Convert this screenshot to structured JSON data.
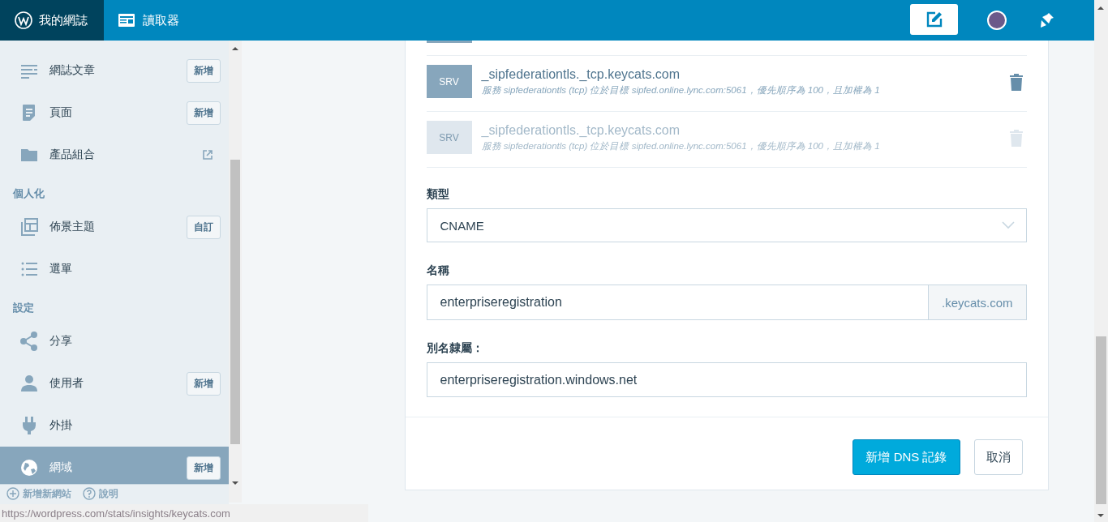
{
  "masterbar": {
    "my_sites": "我的網誌",
    "reader": "讀取器"
  },
  "sidebar": {
    "groups": [
      {
        "items": [
          {
            "label": "網誌文章",
            "kind": "posts",
            "action": {
              "kind": "button",
              "label": "新增"
            },
            "selected": false
          },
          {
            "label": "頁面",
            "kind": "page",
            "action": {
              "kind": "button",
              "label": "新增"
            },
            "selected": false
          },
          {
            "label": "產品組合",
            "kind": "folder",
            "action": {
              "kind": "external"
            },
            "selected": false
          }
        ]
      },
      {
        "heading": "個人化",
        "items": [
          {
            "label": "佈景主題",
            "kind": "themes",
            "action": {
              "kind": "button",
              "label": "自訂"
            },
            "selected": false
          },
          {
            "label": "選單",
            "kind": "menus",
            "selected": false
          }
        ]
      },
      {
        "heading": "設定",
        "items": [
          {
            "label": "分享",
            "kind": "share",
            "selected": false
          },
          {
            "label": "使用者",
            "kind": "user",
            "action": {
              "kind": "button",
              "label": "新增"
            },
            "selected": false
          },
          {
            "label": "外掛",
            "kind": "plugin",
            "selected": false
          },
          {
            "label": "網域",
            "kind": "globe",
            "action": {
              "kind": "button",
              "label": "新增"
            },
            "selected": true
          }
        ]
      }
    ],
    "footer": {
      "add_site": "新增新網站",
      "help": "說明"
    }
  },
  "records": [
    {
      "type": "SRV",
      "name": "_sipfederationtls._tcp.keycats.com",
      "description": "服務 sipfederationtls (tcp) 位於目標 sipfed.online.lync.com:5061，優先順序為 100，且加權為 1",
      "disabled": false
    },
    {
      "type": "SRV",
      "name": "_sipfederationtls._tcp.keycats.com",
      "description": "服務 sipfederationtls (tcp) 位於目標 sipfed.online.lync.com:5061，優先順序為 100，且加權為 1",
      "disabled": true
    }
  ],
  "form": {
    "type_label": "類型",
    "type_value": "CNAME",
    "name_label": "名稱",
    "name_value": "enterpriseregistration",
    "name_suffix": ".keycats.com",
    "alias_label": "別名隸屬：",
    "alias_value": "enterpriseregistration.windows.net",
    "submit": "新增 DNS 記錄",
    "cancel": "取消"
  },
  "status_url": "https://wordpress.com/stats/insights/keycats.com"
}
